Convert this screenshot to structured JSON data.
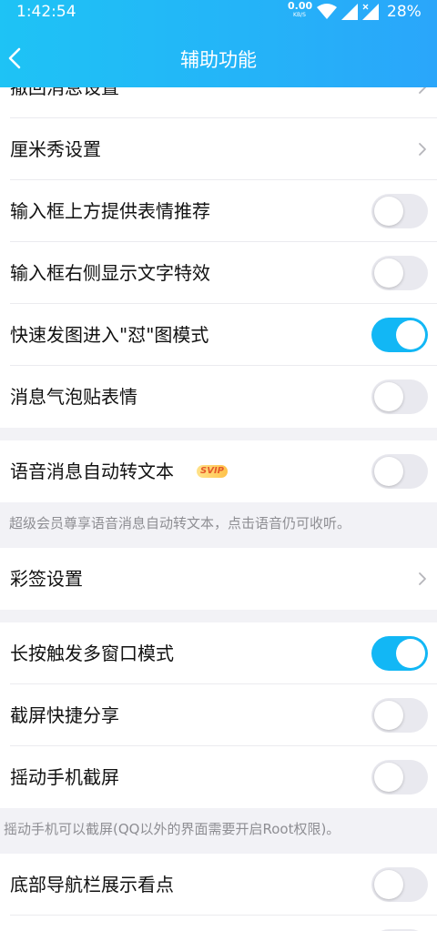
{
  "status_bar": {
    "time": "1:42:54",
    "net_speed_value": "0.00",
    "net_speed_unit": "KB/S",
    "battery": "28%"
  },
  "header": {
    "title": "辅助功能"
  },
  "settings": {
    "recall_label": "撤回消息设置",
    "cmshow_label": "厘米秀设置",
    "emoji_suggest_label": "输入框上方提供表情推荐",
    "emoji_suggest_on": false,
    "text_effect_label": "输入框右侧显示文字特效",
    "text_effect_on": false,
    "quick_image_label": "快速发图进入\"怼\"图模式",
    "quick_image_on": true,
    "bubble_sticker_label": "消息气泡贴表情",
    "bubble_sticker_on": false,
    "voice_to_text_label": "语音消息自动转文本",
    "svip_badge": "SVIP",
    "voice_to_text_on": false,
    "voice_hint": "超级会员尊享语音消息自动转文本，点击语音仍可收听。",
    "color_sign_label": "彩签设置",
    "multi_window_label": "长按触发多窗口模式",
    "multi_window_on": true,
    "screenshot_share_label": "截屏快捷分享",
    "screenshot_share_on": false,
    "shake_screenshot_label": "摇动手机截屏",
    "shake_screenshot_on": false,
    "shake_hint": "摇动手机可以截屏(QQ以外的界面需要开启Root权限)。",
    "navbar_kandian_label": "底部导航栏展示看点",
    "navbar_kandian_on": false
  },
  "colors": {
    "accent": "#12b7f5",
    "header_start": "#1ec3f5",
    "header_end": "#2aa6fa",
    "svip": "#e55a2b"
  }
}
